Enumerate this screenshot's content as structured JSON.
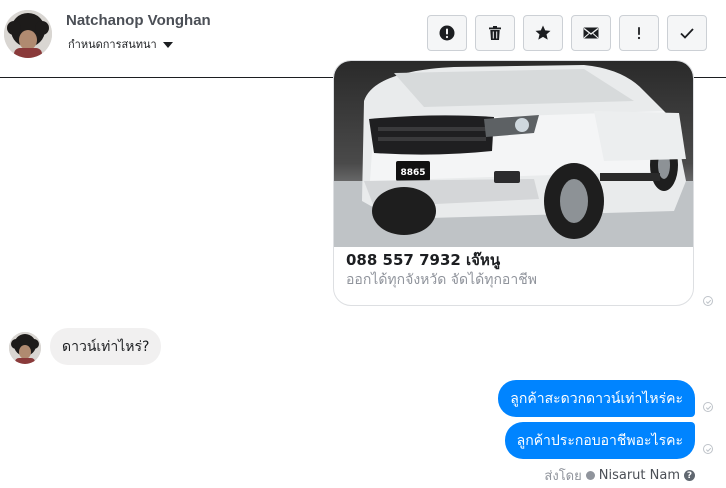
{
  "header": {
    "name": "Natchanop Vonghan",
    "subtitle": "กำหนดการสนทนา",
    "toolbar": [
      {
        "icon": "alert-circle-icon"
      },
      {
        "icon": "trash-icon"
      },
      {
        "icon": "star-icon"
      },
      {
        "icon": "envelope-icon"
      },
      {
        "icon": "exclamation-icon"
      },
      {
        "icon": "checkmark-icon"
      }
    ]
  },
  "messages": {
    "card": {
      "plate": "8865",
      "title": "088 557 7932 เจ๊หนู",
      "subtitle": "ออกได้ทุกจังหวัด จัดได้ทุกอาชีพ"
    },
    "incoming": [
      {
        "text": "ดาวน์เท่าไหร่?"
      }
    ],
    "outgoing": [
      {
        "text": "ลูกค้าสะดวกดาวน์เท่าไหร่คะ"
      },
      {
        "text": "ลูกค้าประกอบอาชีพอะไรคะ"
      }
    ],
    "sent_by": {
      "label": "ส่งโดย",
      "name": "Nisarut Nam",
      "help": "?"
    }
  },
  "colors": {
    "accent": "#0084ff",
    "incoming_bubble": "#f1f0f0",
    "muted_text": "#90949c"
  }
}
